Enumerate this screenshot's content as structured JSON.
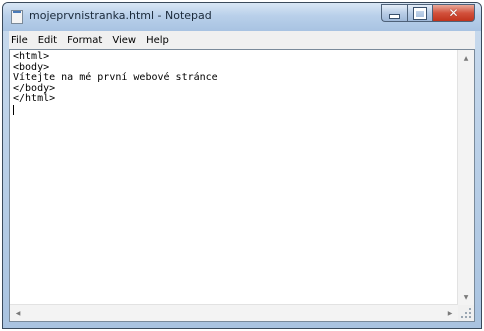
{
  "window": {
    "title": "mojeprvnistranka.html - Notepad"
  },
  "icons": {
    "app": "notepad-icon",
    "minimize": "minimize-icon",
    "maximize": "maximize-icon",
    "close": "close-icon"
  },
  "menu": {
    "items": [
      {
        "label": "File"
      },
      {
        "label": "Edit"
      },
      {
        "label": "Format"
      },
      {
        "label": "View"
      },
      {
        "label": "Help"
      }
    ]
  },
  "editor": {
    "lines": [
      "<html>",
      "<body>",
      "Vítejte na mé první webové stránce",
      "</body>",
      "</html>"
    ]
  },
  "colors": {
    "titlebar": "#b9d0ea",
    "close_button": "#d2513c",
    "menubar": "#f0f0f0",
    "editor_bg": "#ffffff"
  }
}
